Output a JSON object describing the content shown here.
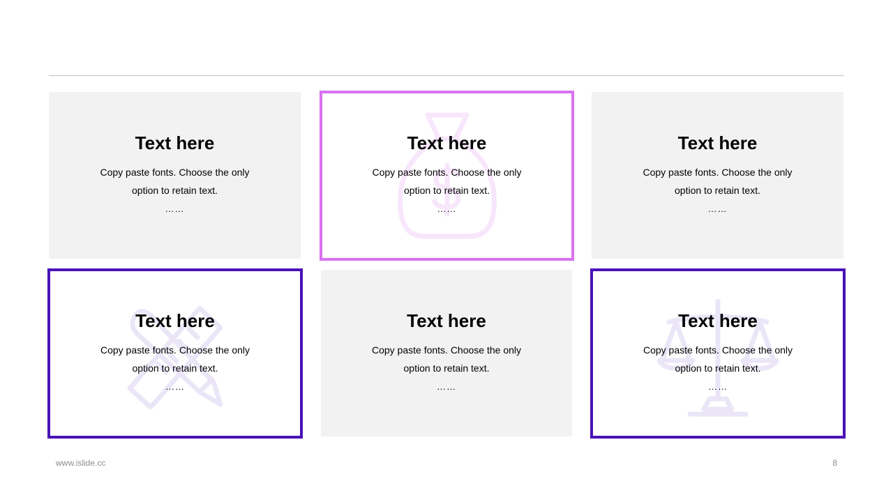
{
  "cards": [
    {
      "title": "Text here",
      "body": "Copy paste fonts. Choose the only option to retain text.",
      "dots": "……"
    },
    {
      "title": "Text here",
      "body": "Copy paste fonts. Choose the only option to retain text.",
      "dots": "……"
    },
    {
      "title": "Text here",
      "body": "Copy paste fonts. Choose the only option to retain text.",
      "dots": "……"
    },
    {
      "title": "Text here",
      "body": "Copy paste fonts. Choose the only option to retain text.",
      "dots": "……"
    },
    {
      "title": "Text here",
      "body": "Copy paste fonts. Choose the only option to retain text.",
      "dots": "……"
    },
    {
      "title": "Text here",
      "body": "Copy paste fonts. Choose the only option to retain text.",
      "dots": "……"
    }
  ],
  "icons": {
    "card2": "money-bag-icon",
    "card4": "ruler-pencil-icon",
    "card6": "scales-icon"
  },
  "colors": {
    "card_gray": "#f2f2f2",
    "accent_pink": "#d872f0",
    "accent_purple": "#4a12b8"
  },
  "footer": {
    "website": "www.islide.cc",
    "page_number": "8"
  }
}
